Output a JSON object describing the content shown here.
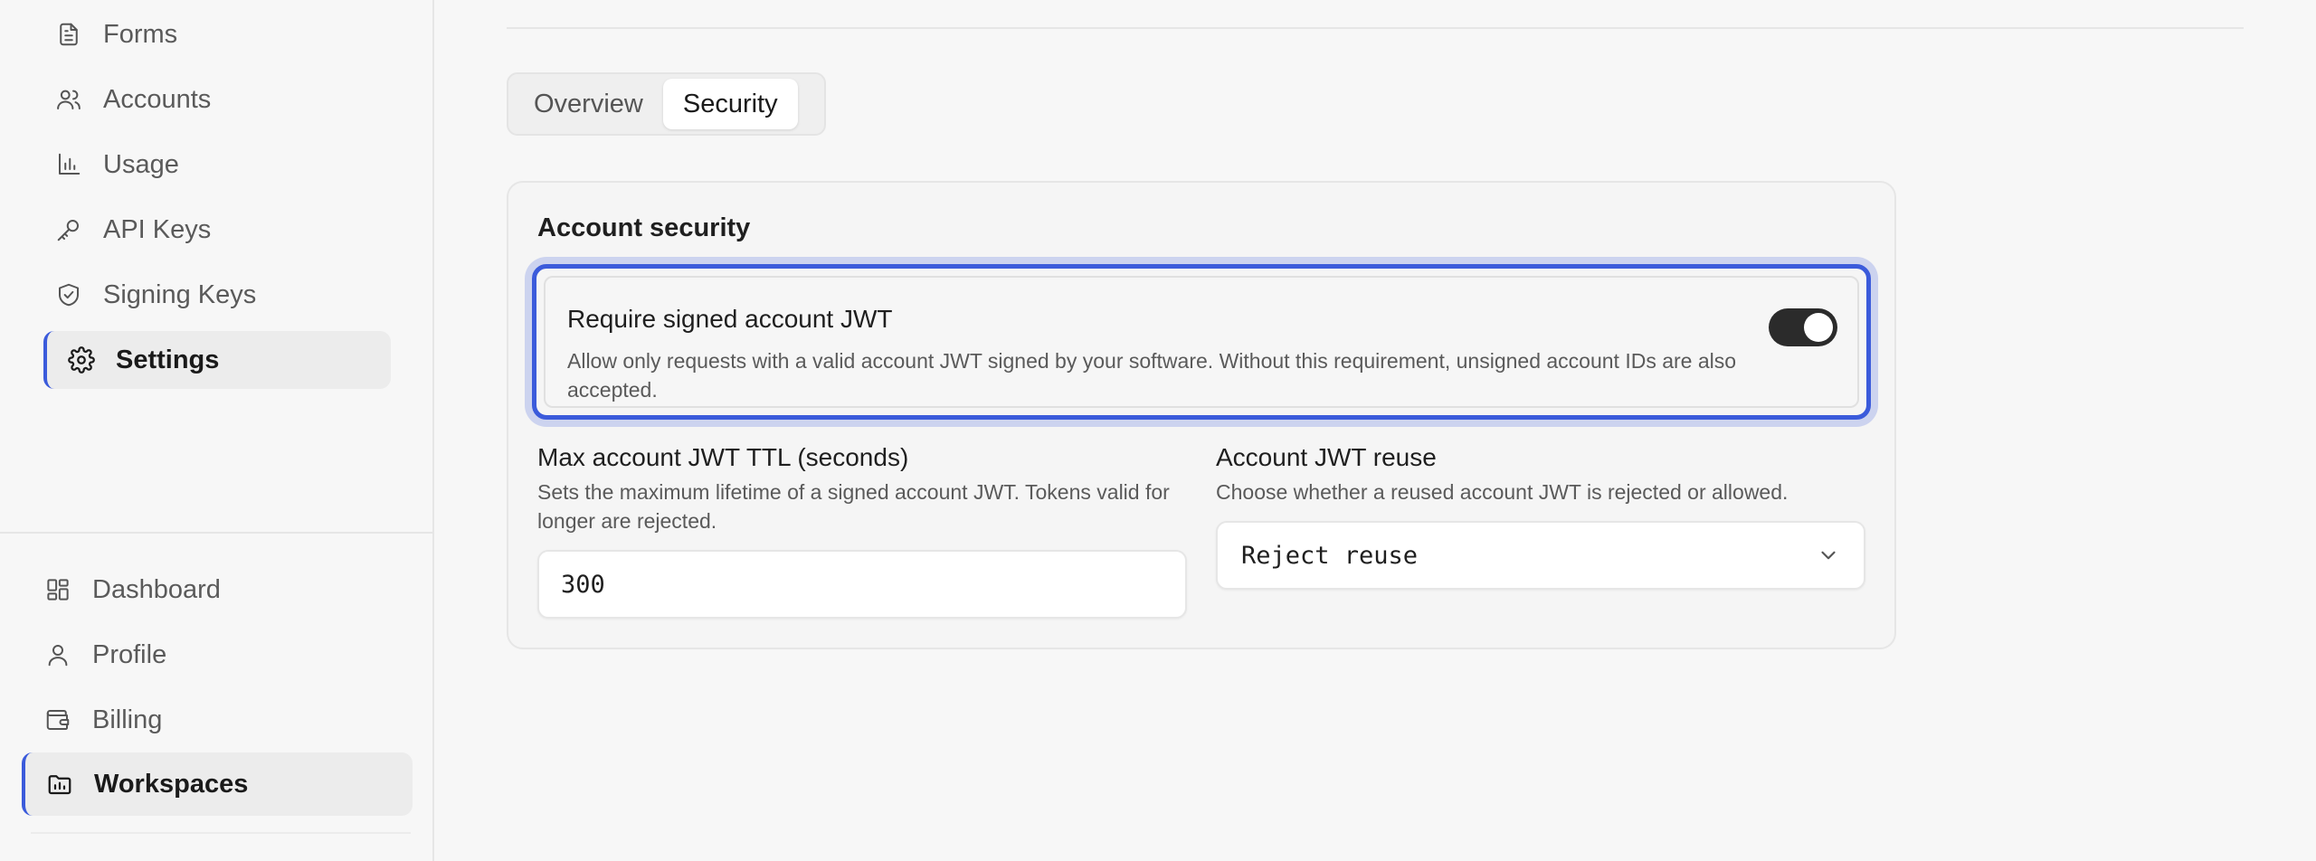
{
  "sidebar": {
    "top_items": [
      {
        "label": "Forms",
        "icon": "document-icon"
      },
      {
        "label": "Accounts",
        "icon": "users-icon"
      },
      {
        "label": "Usage",
        "icon": "bar-chart-icon"
      },
      {
        "label": "API Keys",
        "icon": "key-icon"
      },
      {
        "label": "Signing Keys",
        "icon": "shield-check-icon"
      },
      {
        "label": "Settings",
        "icon": "gear-icon",
        "active": true
      }
    ],
    "bottom_items": [
      {
        "label": "Dashboard",
        "icon": "dashboard-icon"
      },
      {
        "label": "Profile",
        "icon": "user-icon"
      },
      {
        "label": "Billing",
        "icon": "wallet-icon"
      },
      {
        "label": "Workspaces",
        "icon": "folder-icon",
        "active": true
      }
    ]
  },
  "tabs": [
    {
      "label": "Overview",
      "active": false
    },
    {
      "label": "Security",
      "active": true
    }
  ],
  "account_security": {
    "title": "Account security",
    "require_jwt": {
      "title": "Require signed account JWT",
      "description": "Allow only requests with a valid account JWT signed by your software. Without this requirement, unsigned account IDs are also accepted.",
      "enabled": true
    },
    "max_ttl": {
      "label": "Max account JWT TTL (seconds)",
      "help": "Sets the maximum lifetime of a signed account JWT. Tokens valid for longer are rejected.",
      "value": "300"
    },
    "jwt_reuse": {
      "label": "Account JWT reuse",
      "help": "Choose whether a reused account JWT is rejected or allowed.",
      "selected": "Reject reuse"
    }
  },
  "colors": {
    "accent": "#3b5bdb",
    "toggle_on": "#2b2b2b",
    "background": "#f7f7f7"
  }
}
